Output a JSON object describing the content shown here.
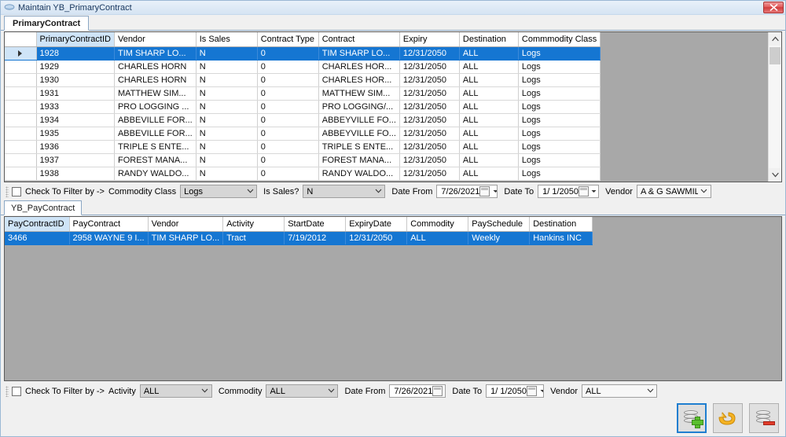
{
  "window": {
    "title": "Maintain YB_PrimaryContract",
    "icon": "app-diamond-icon",
    "close_label": "✕"
  },
  "top_tabs": [
    {
      "label": "PrimaryContract",
      "active": true
    }
  ],
  "primary_grid": {
    "columns": [
      {
        "label": "",
        "key": false,
        "width": 40
      },
      {
        "label": "PrimaryContractID",
        "key": true,
        "width": 85
      },
      {
        "label": "Vendor",
        "key": false,
        "width": 78
      },
      {
        "label": "Is Sales",
        "key": false,
        "width": 78
      },
      {
        "label": "Contract Type",
        "key": false,
        "width": 78
      },
      {
        "label": "Contract",
        "key": false,
        "width": 80
      },
      {
        "label": "Expiry",
        "key": false,
        "width": 76
      },
      {
        "label": "Destination",
        "key": false,
        "width": 75
      },
      {
        "label": "Commmodity Class",
        "key": false,
        "width": 80
      }
    ],
    "rows": [
      {
        "selected": true,
        "marker": "▶",
        "cells": [
          "1928",
          "TIM SHARP LO...",
          "N",
          "0",
          "TIM SHARP LO...",
          "12/31/2050",
          "ALL",
          "Logs"
        ]
      },
      {
        "selected": false,
        "marker": "",
        "cells": [
          "1929",
          "CHARLES HORN",
          "N",
          "0",
          "CHARLES  HOR...",
          "12/31/2050",
          "ALL",
          "Logs"
        ]
      },
      {
        "selected": false,
        "marker": "",
        "cells": [
          "1930",
          "CHARLES HORN",
          "N",
          "0",
          "CHARLES  HOR...",
          "12/31/2050",
          "ALL",
          "Logs"
        ]
      },
      {
        "selected": false,
        "marker": "",
        "cells": [
          "1931",
          "MATTHEW SIM...",
          "N",
          "0",
          "MATTHEW SIM...",
          "12/31/2050",
          "ALL",
          "Logs"
        ]
      },
      {
        "selected": false,
        "marker": "",
        "cells": [
          "1933",
          "PRO LOGGING ...",
          "N",
          "0",
          "PRO LOGGING/...",
          "12/31/2050",
          "ALL",
          "Logs"
        ]
      },
      {
        "selected": false,
        "marker": "",
        "cells": [
          "1934",
          "ABBEVILLE FOR...",
          "N",
          "0",
          "ABBEYVILLE FO...",
          "12/31/2050",
          "ALL",
          "Logs"
        ]
      },
      {
        "selected": false,
        "marker": "",
        "cells": [
          "1935",
          "ABBEVILLE FOR...",
          "N",
          "0",
          "ABBEYVILLE FO...",
          "12/31/2050",
          "ALL",
          "Logs"
        ]
      },
      {
        "selected": false,
        "marker": "",
        "cells": [
          "1936",
          "TRIPLE S ENTE...",
          "N",
          "0",
          "TRIPLE S ENTE...",
          "12/31/2050",
          "ALL",
          "Logs"
        ]
      },
      {
        "selected": false,
        "marker": "",
        "cells": [
          "1937",
          "FOREST MANA...",
          "N",
          "0",
          "FOREST MANA...",
          "12/31/2050",
          "ALL",
          "Logs"
        ]
      },
      {
        "selected": false,
        "marker": "",
        "cells": [
          "1938",
          "RANDY WALDO...",
          "N",
          "0",
          "RANDY WALDO...",
          "12/31/2050",
          "ALL",
          "Logs"
        ]
      }
    ],
    "scrollbar": {
      "up": "⌃",
      "down": "⌄"
    }
  },
  "primary_filter": {
    "checkbox_checked": false,
    "check_label": "Check To Filter by ->",
    "commodity_class_label": "Commmodity Class",
    "commodity_class_label_shown": "Commodity Class",
    "commodity_class_value": "Logs",
    "is_sales_label": "Is Sales?",
    "is_sales_value": "N",
    "date_from_label": "Date From",
    "date_from_value": "7/26/2021",
    "date_to_label": "Date To",
    "date_to_value": "1/  1/2050",
    "vendor_label": "Vendor",
    "vendor_value": "A & G SAWMILL",
    "dropdown_glyph": "⌄",
    "spin_glyph": "▾"
  },
  "bottom_tabs": [
    {
      "label": "YB_PayContract",
      "active": true
    }
  ],
  "pay_grid": {
    "columns": [
      {
        "label": "PayContractID",
        "key": true,
        "width": 82
      },
      {
        "label": "PayContract",
        "key": false,
        "width": 80
      },
      {
        "label": "Vendor",
        "key": false,
        "width": 78
      },
      {
        "label": "Activity",
        "key": false,
        "width": 78
      },
      {
        "label": "StartDate",
        "key": false,
        "width": 78
      },
      {
        "label": "ExpiryDate",
        "key": false,
        "width": 78
      },
      {
        "label": "Commodity",
        "key": false,
        "width": 78
      },
      {
        "label": "PaySchedule",
        "key": false,
        "width": 78
      },
      {
        "label": "Destination",
        "key": false,
        "width": 80
      }
    ],
    "rows": [
      {
        "selected": true,
        "cells": [
          "3466",
          "2958 WAYNE 9 I...",
          "TIM SHARP LO...",
          "Tract",
          "7/19/2012",
          "12/31/2050",
          "ALL",
          "Weekly",
          "Hankins INC"
        ]
      }
    ]
  },
  "pay_filter": {
    "checkbox_checked": false,
    "check_label": "Check To Filter by ->",
    "activity_label": "Activity",
    "activity_value": "ALL",
    "commodity_label": "Commodity",
    "commodity_value": "ALL",
    "date_from_label": "Date From",
    "date_from_value": "7/26/2021",
    "date_to_label": "Date To",
    "date_to_value": "1/  1/2050",
    "vendor_label": "Vendor",
    "vendor_value": "ALL",
    "dropdown_glyph": "⌄",
    "spin_glyph": "▾"
  },
  "actions": [
    {
      "name": "add-record-button",
      "icon": "database-add-icon",
      "focused": true
    },
    {
      "name": "undo-button",
      "icon": "undo-arrow-icon",
      "focused": false
    },
    {
      "name": "delete-record-button",
      "icon": "database-delete-icon",
      "focused": false
    }
  ],
  "colors": {
    "selection_blue": "#1576d2",
    "key_header_blue": "#cfe4f7",
    "grid_empty_gray": "#a8a8a8",
    "window_chrome": "#f0f0f0",
    "accent_border": "#1f7ed0",
    "close_red": "#cf3b3b"
  }
}
